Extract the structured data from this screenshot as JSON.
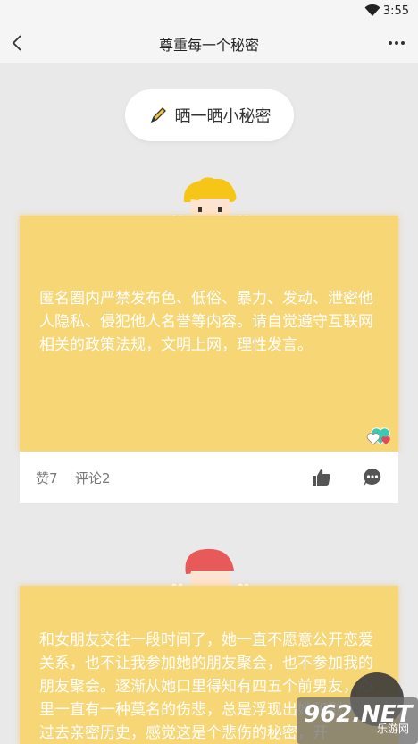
{
  "status_bar": {
    "time": "3:55"
  },
  "nav": {
    "title": "尊重每一个秘密"
  },
  "post_button": {
    "label": "晒一晒小秘密"
  },
  "posts": [
    {
      "text": "匿名圈内严禁发布色、低俗、暴力、发动、泄密他人隐私、侵犯他人名誉等内容。请自觉遵守互联网相关的政策法规，文明上网，理性发言。",
      "likes_label": "赞7",
      "comments_label": "评论2",
      "hair_color": "#f5c518"
    },
    {
      "text": "和女朋友交往一段时间了，她一直不愿意公开恋爱关系，也不让我参加她的朋友聚会，也不参加我的朋友聚会。逐渐从她口里得知有四五个前男友，心里一直有一种莫名的伤悲，总是浮现出她和别人的过去亲密历史，感觉这是个悲伤的秘密，开",
      "hair_color": "#e85a5a"
    }
  ],
  "watermark": {
    "number": "962.NET",
    "sub": "乐游网"
  }
}
